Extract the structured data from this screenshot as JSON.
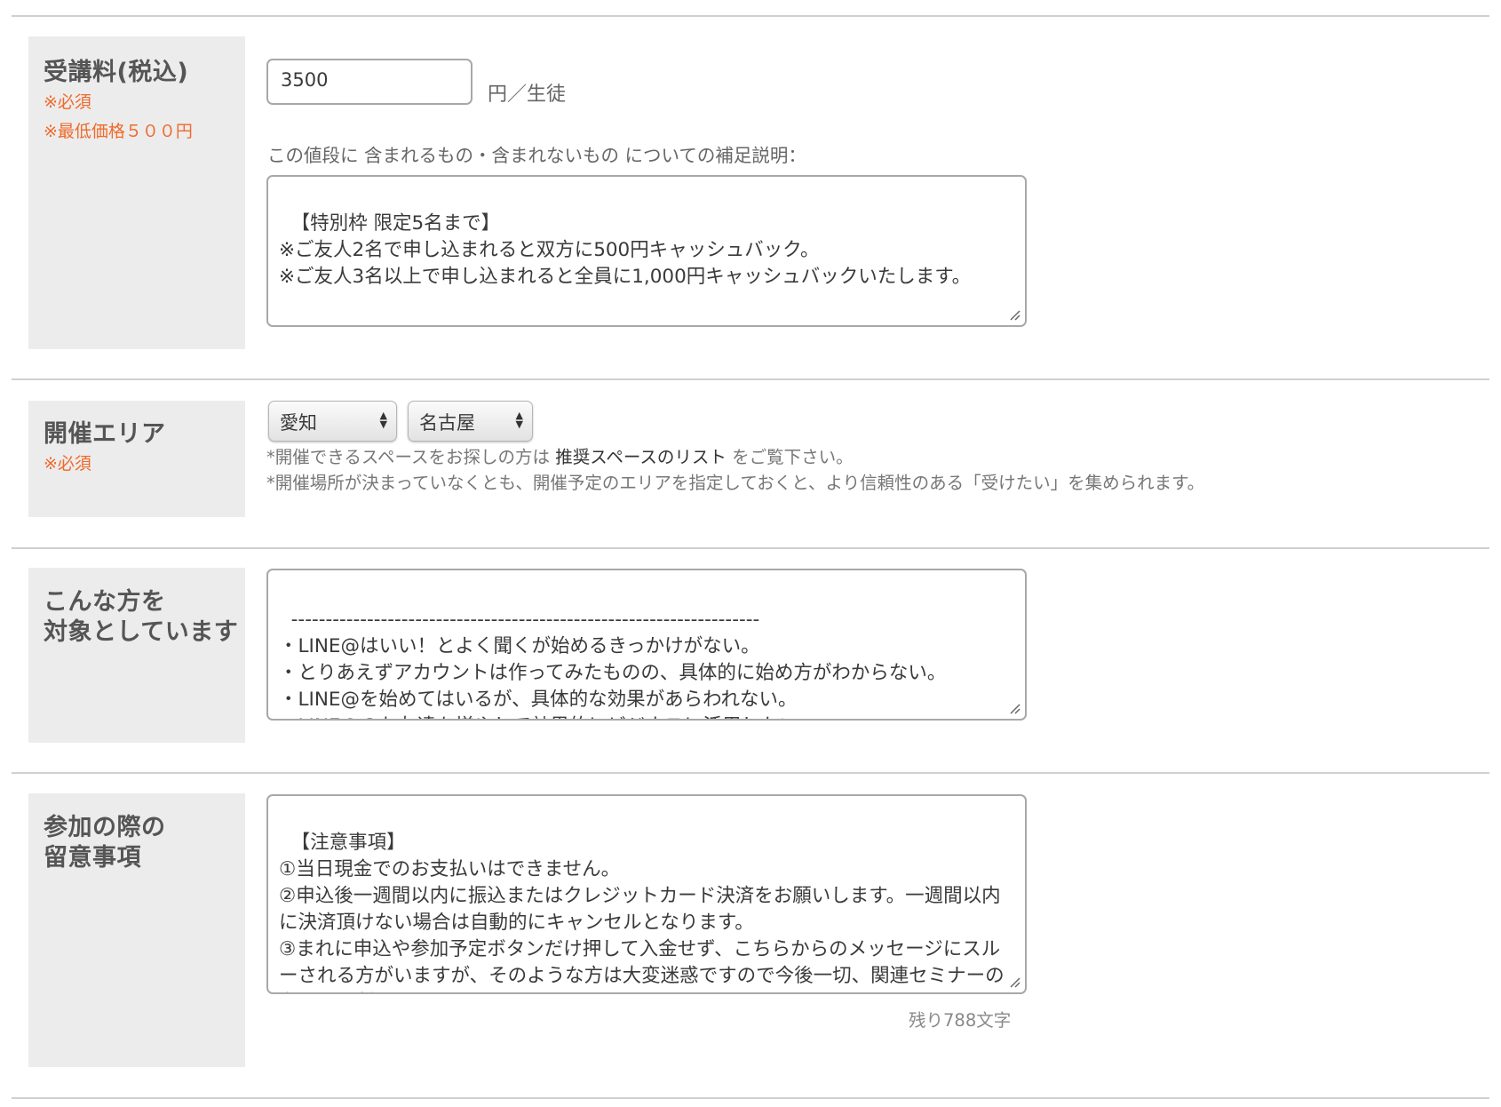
{
  "fee": {
    "title": "受講料(税込)",
    "required": "※必須",
    "min_price": "※最低価格５００円",
    "value": "3500",
    "unit": "円／生徒",
    "desc_label": "この値段に 含まれるもの・含まれないもの についての補足説明：",
    "desc_text": "【特別枠 限定5名まで】\n※ご友人2名で申し込まれると双方に500円キャッシュバック。\n※ご友人3名以上で申し込まれると全員に1,000円キャッシュバックいたします。"
  },
  "area": {
    "title": "開催エリア",
    "required": "※必須",
    "prefecture": "愛知",
    "city": "名古屋",
    "note1_prefix": "*開催できるスペースをお探しの方は ",
    "note1_link": "推奨スペースのリスト",
    "note1_suffix": " をご覧下さい。",
    "note2": "*開催場所が決まっていなくとも、開催予定のエリアを指定しておくと、より信頼性のある「受けたい」を集められます。"
  },
  "target": {
    "title_line1": "こんな方を",
    "title_line2": "対象としています",
    "text": "--------------------------------------------------------------------\n・LINE@はいい！とよく聞くが始めるきっかけがない。\n・とりあえずアカウントは作ってみたものの、具体的に始め方がわからない。\n・LINE@を始めてはいるが、具体的な効果があらわれない。\n・LINE@のお友達を増やして効果的にビジネスに活用したい。\n・どんな機能があるか、複雑すぎて活用できていない。"
  },
  "notes": {
    "title_line1": "参加の際の",
    "title_line2": "留意事項",
    "text": "【注意事項】\n①当日現金でのお支払いはできません。\n②申込後一週間以内に振込またはクレジットカード決済をお願いします。一週間以内に決済頂けない場合は自動的にキャンセルとなります。\n③まれに申込や参加予定ボタンだけ押して入金せず、こちらからのメッセージにスルーされる方がいますが、そのような方は大変迷惑ですので今後一切、関連セミナーの参加をお断りいたします。",
    "remaining": "残り788文字"
  }
}
